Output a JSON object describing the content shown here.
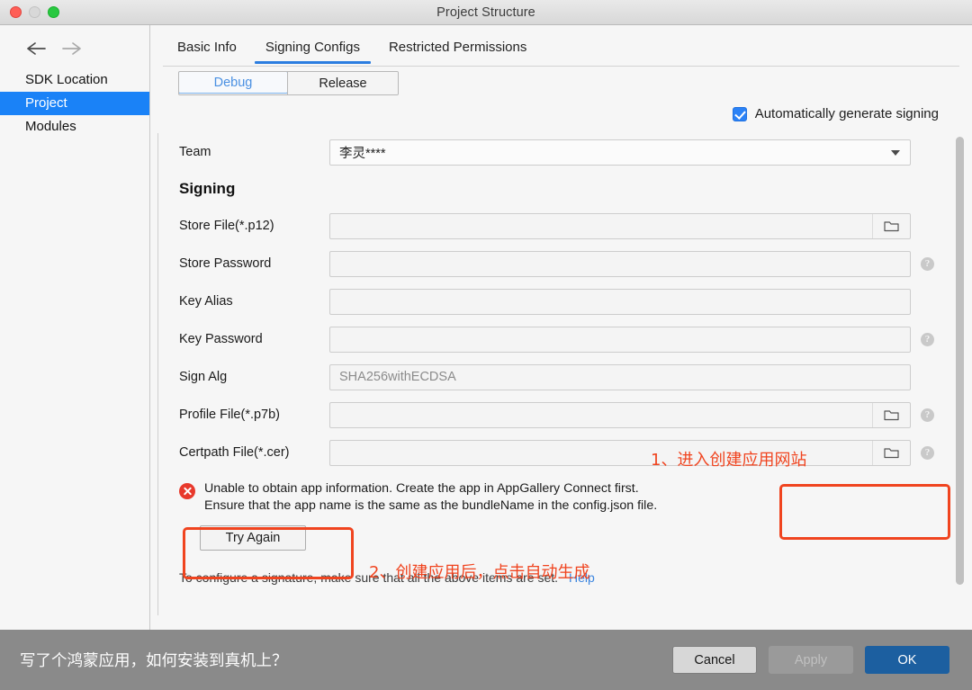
{
  "window": {
    "title": "Project Structure",
    "traffic_lights": [
      "close-button",
      "minimize-button",
      "maximize-button"
    ]
  },
  "sidebar": {
    "back_icon": "back-arrow-icon",
    "forward_icon": "forward-arrow-icon",
    "items": [
      {
        "label": "SDK Location",
        "selected": false
      },
      {
        "label": "Project",
        "selected": true
      },
      {
        "label": "Modules",
        "selected": false
      }
    ]
  },
  "tabs": [
    {
      "label": "Basic Info",
      "active": false
    },
    {
      "label": "Signing Configs",
      "active": true
    },
    {
      "label": "Restricted Permissions",
      "active": false
    }
  ],
  "segmented": {
    "options": [
      {
        "label": "Debug",
        "active": true
      },
      {
        "label": "Release",
        "active": false
      }
    ]
  },
  "auto_generate": {
    "label": "Automatically generate signing",
    "checked": true
  },
  "form": {
    "team": {
      "label": "Team",
      "value": "李灵****",
      "type": "dropdown"
    },
    "section_title": "Signing",
    "fields": [
      {
        "label": "Store File(*.p12)",
        "value": "",
        "folder": true,
        "help": false
      },
      {
        "label": "Store Password",
        "value": "",
        "folder": false,
        "help": true
      },
      {
        "label": "Key Alias",
        "value": "",
        "folder": false,
        "help": false
      },
      {
        "label": "Key Password",
        "value": "",
        "folder": false,
        "help": true
      },
      {
        "label": "Sign Alg",
        "value": "SHA256withECDSA",
        "folder": false,
        "help": false,
        "readonly": true
      },
      {
        "label": "Profile File(*.p7b)",
        "value": "",
        "folder": true,
        "help": true
      },
      {
        "label": "Certpath File(*.cer)",
        "value": "",
        "folder": true,
        "help": true
      }
    ]
  },
  "error": {
    "icon": "error-circle-icon",
    "line1": "Unable to obtain app information. Create the app in AppGallery Connect first.",
    "line2": "Ensure that the app name is the same as the bundleName in the config.json file.",
    "try_again_label": "Try Again",
    "link_label": "AppGallery Connect"
  },
  "footnote": {
    "text": "To configure a signature, make sure that all the above items are set.",
    "help_label": "Help"
  },
  "annotations": {
    "step1": "1、进入创建应用网站",
    "step2": "2、创建应用后，点击自动生成",
    "highlight_color": "#f0441f"
  },
  "bottom_bar": {
    "caption": "写了个鸿蒙应用，如何安装到真机上？",
    "buttons": [
      {
        "label": "Cancel",
        "state": "enabled"
      },
      {
        "label": "Apply",
        "state": "disabled"
      },
      {
        "label": "OK",
        "state": "primary"
      }
    ]
  }
}
